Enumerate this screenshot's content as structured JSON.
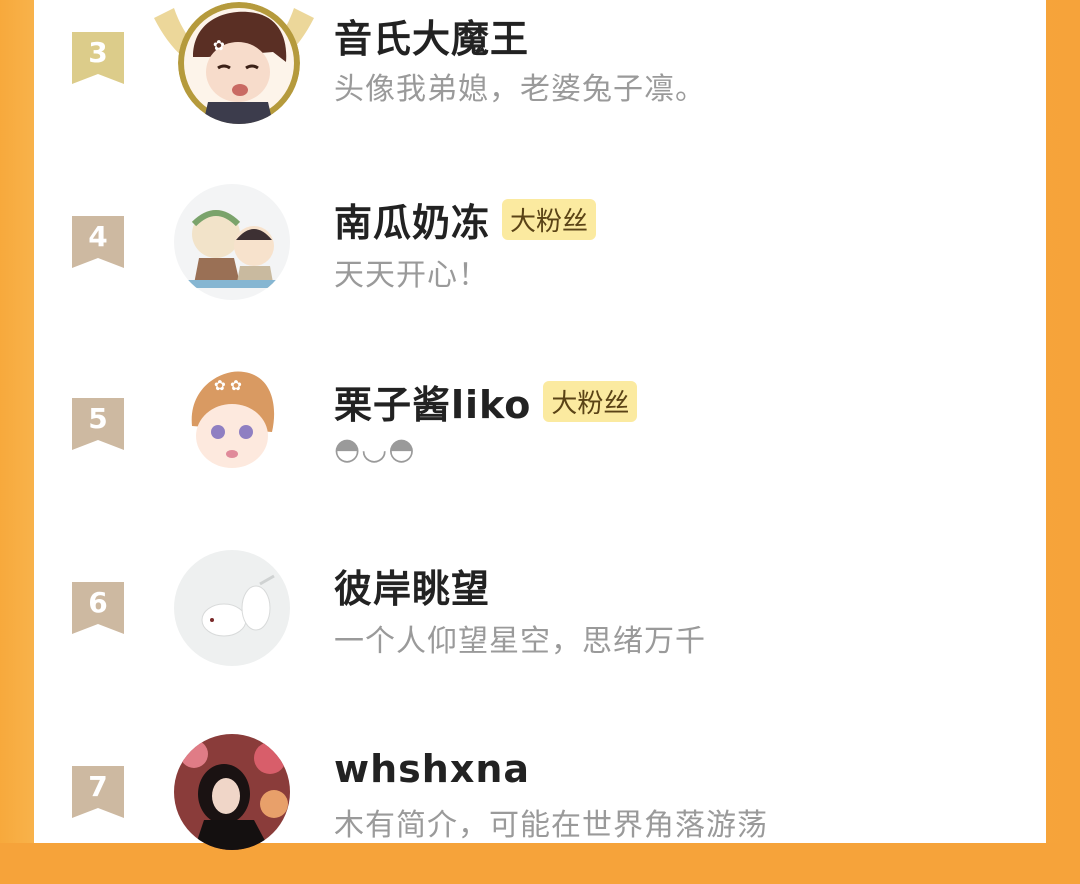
{
  "leaderboard": {
    "entries": [
      {
        "rank": "3",
        "name": "音氏大魔王",
        "badge": "",
        "bio": "头像我弟媳，老婆兔子凛。"
      },
      {
        "rank": "4",
        "name": "南瓜奶冻",
        "badge": "大粉丝",
        "bio": "天天开心！"
      },
      {
        "rank": "5",
        "name": "栗子酱liko",
        "badge": "大粉丝",
        "bio": "◓◡◓"
      },
      {
        "rank": "6",
        "name": "彼岸眺望",
        "badge": "",
        "bio": "一个人仰望星空，思绪万千"
      },
      {
        "rank": "7",
        "name": "whshxna",
        "badge": "",
        "bio": "木有简介，可能在世界角落游荡"
      }
    ]
  },
  "colors": {
    "background": "#f6a33a",
    "rank3_ribbon": "#dccc8a",
    "rank_ribbon": "#cdb9a1",
    "badge_bg": "#fbeaa0",
    "name": "#222222",
    "bio": "#9a9a9a"
  }
}
